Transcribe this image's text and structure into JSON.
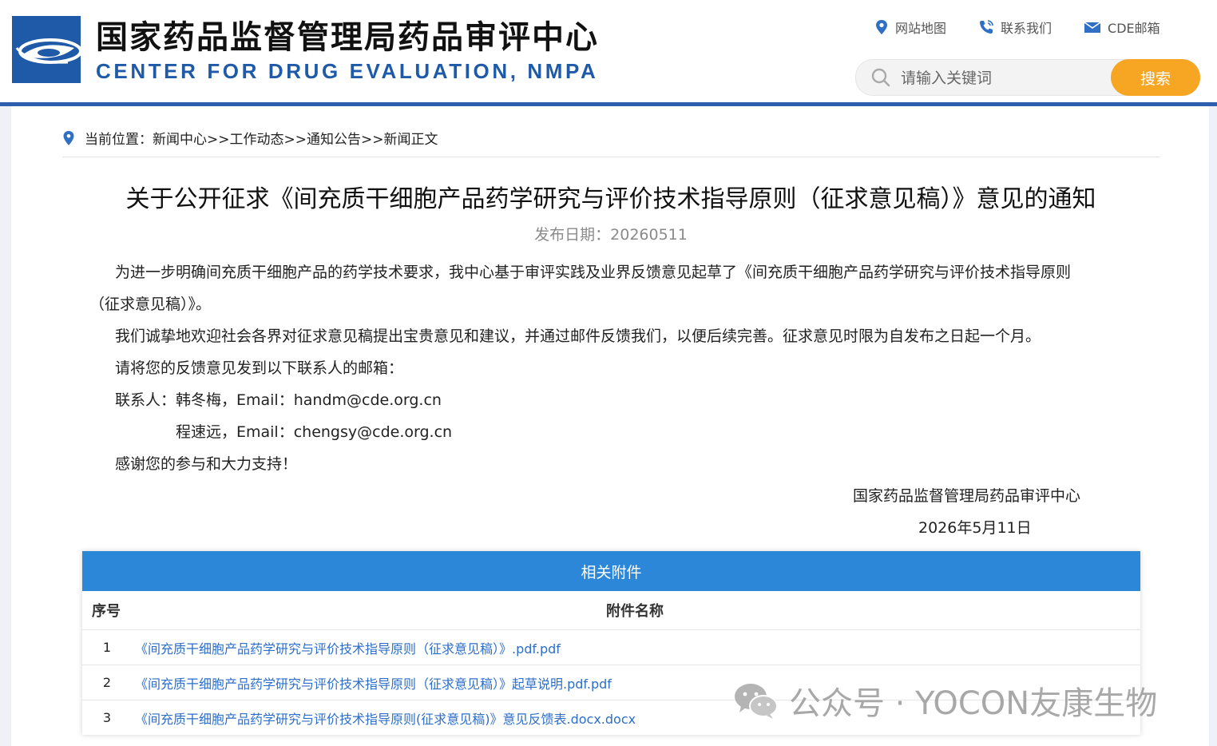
{
  "header": {
    "title": "国家药品监督管理局药品审评中心",
    "subtitle": "CENTER FOR DRUG EVALUATION, NMPA",
    "links": [
      {
        "label": "网站地图",
        "icon": "location-pin-icon"
      },
      {
        "label": "联系我们",
        "icon": "phone-icon"
      },
      {
        "label": "CDE邮箱",
        "icon": "mail-icon"
      }
    ],
    "search": {
      "placeholder": "请输入关键词",
      "button_label": "搜索"
    }
  },
  "breadcrumb": {
    "label": "当前位置：",
    "path": "新闻中心>>工作动态>>通知公告>>新闻正文"
  },
  "article": {
    "title": "关于公开征求《间充质干细胞产品药学研究与评价技术指导原则（征求意见稿）》意见的通知",
    "date": "发布日期：20260511",
    "p1a": "为进一步明确间充质干细胞产品的药学技术要求，我中心基于审评实践及业界反馈意见起草了《间充质干细胞产品药学研究与评价技术指导原则",
    "p1b": "（征求意见稿）》。",
    "p2": "我们诚挚地欢迎社会各界对征求意见稿提出宝贵意见和建议，并通过邮件反馈我们，以便后续完善。征求意见时限为自发布之日起一个月。",
    "p3": "请将您的反馈意见发到以下联系人的邮箱：",
    "contact1": "联系人：韩冬梅，Email：handm@cde.org.cn",
    "contact2": "程速远，Email：chengsy@cde.org.cn",
    "thanks": "感谢您的参与和大力支持！",
    "signature": "国家药品监督管理局药品审评中心",
    "sign_date": "2026年5月11日"
  },
  "attachments": {
    "title": "相关附件",
    "col_index": "序号",
    "col_name": "附件名称",
    "rows": [
      {
        "index": "1",
        "name": "《间充质干细胞产品药学研究与评价技术指导原则（征求意见稿）》.pdf.pdf"
      },
      {
        "index": "2",
        "name": "《间充质干细胞产品药学研究与评价技术指导原则（征求意见稿）》起草说明.pdf.pdf"
      },
      {
        "index": "3",
        "name": "《间充质干细胞产品药学研究与评价技术指导原则(征求意见稿)》意见反馈表.docx.docx"
      }
    ]
  },
  "watermark": {
    "text": "公众号 · YOCON友康生物",
    "icon": "wechat-icon"
  },
  "colors": {
    "brand_blue": "#2e5fae",
    "search_orange": "#f6a623",
    "table_header": "#2d87d8",
    "link": "#2d6ec8"
  }
}
